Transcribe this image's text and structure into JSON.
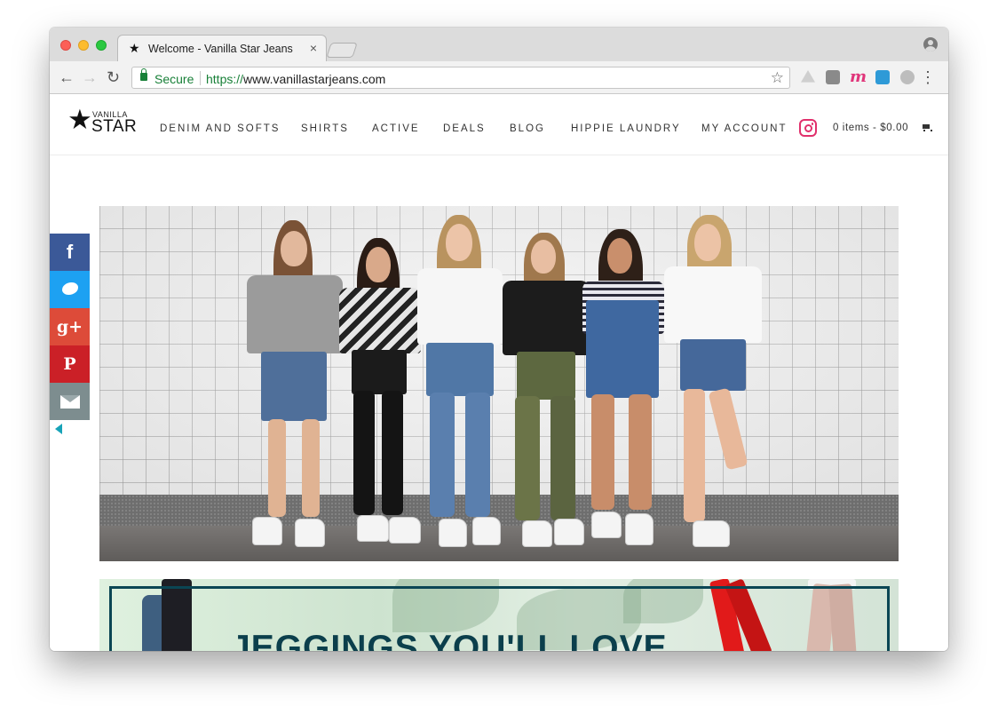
{
  "browser": {
    "tab_title": "Welcome - Vanilla Star Jeans",
    "secure_label": "Secure",
    "url_scheme": "https://",
    "url_host": "www.vanillastarjeans.com"
  },
  "site": {
    "logo_small": "VANILLA",
    "logo_big": "STAR",
    "nav": [
      "DENIM AND SOFTS",
      "SHIRTS",
      "ACTIVE",
      "DEALS",
      "BLOG",
      "HIPPIE LAUNDRY",
      "MY ACCOUNT"
    ],
    "cart_text": "0 items - $0.00"
  },
  "share": {
    "facebook_glyph": "f",
    "googleplus_glyph": "g+",
    "pinterest_glyph": "P"
  },
  "promo": {
    "headline": "JEGGINGS YOU'LL LOVE"
  },
  "colors": {
    "secure_green": "#188038",
    "instagram_pink": "#e1306c",
    "facebook": "#3b5998",
    "twitter": "#1da1f2",
    "googleplus": "#dd4b39",
    "pinterest": "#cb2027",
    "email": "#7d8d8f",
    "promo_navy": "#0b4654"
  }
}
